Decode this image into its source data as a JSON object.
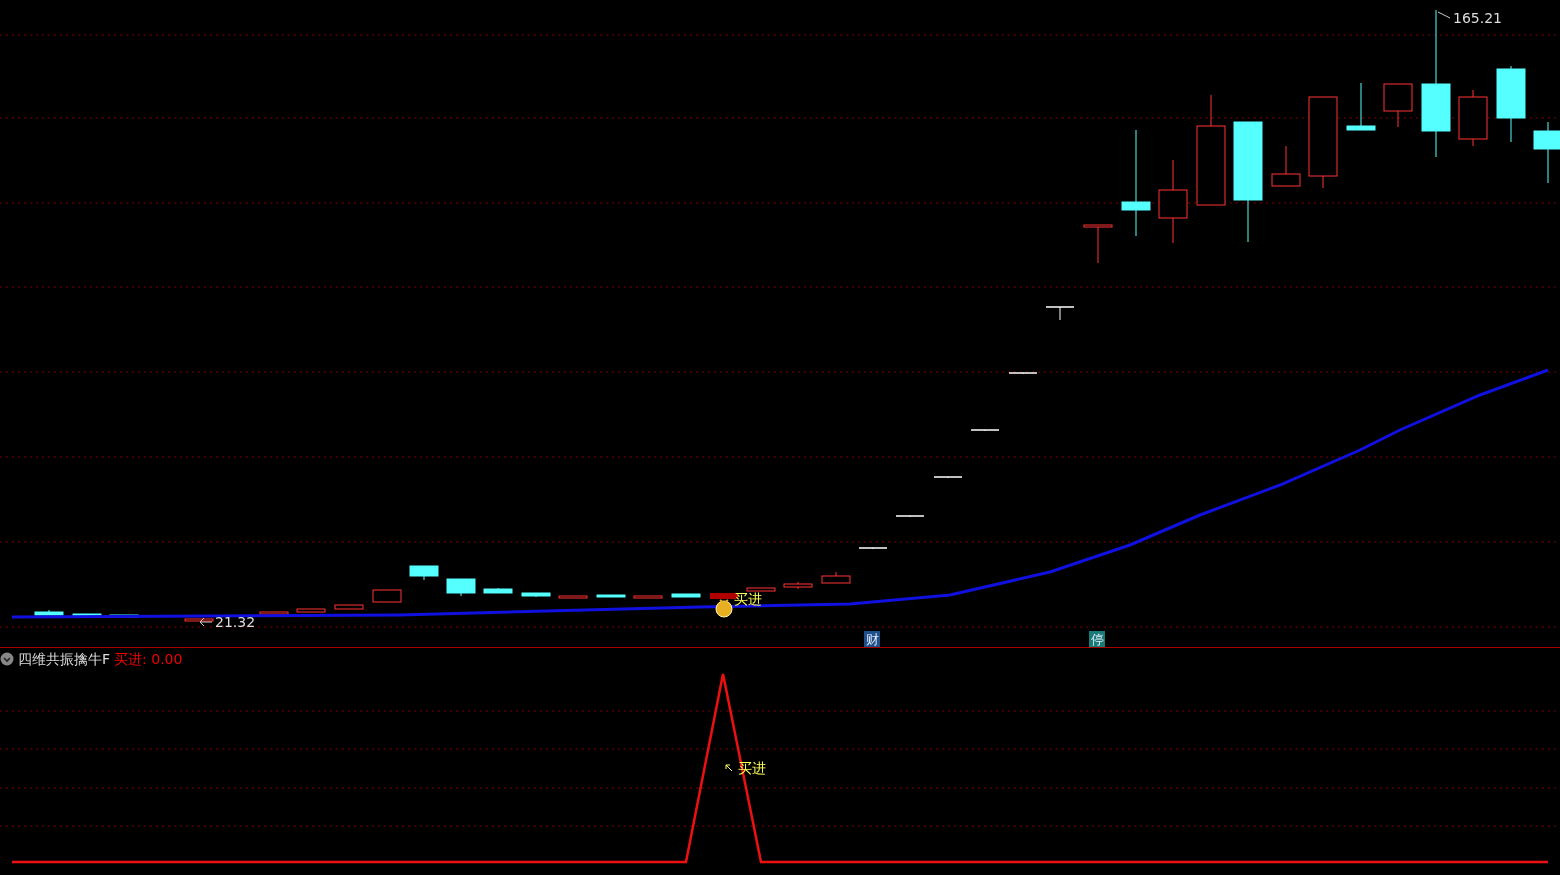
{
  "main_chart": {
    "high_label": "165.21",
    "low_label": "21.32",
    "signal_label": "买进",
    "markers": [
      {
        "text": "财",
        "color": "#1f4f8a"
      },
      {
        "text": "停",
        "color": "#1a7a78"
      }
    ]
  },
  "indicator": {
    "name": "四维共振擒牛F",
    "value_label": "买进: 0.00",
    "signal_label": "买进"
  }
}
